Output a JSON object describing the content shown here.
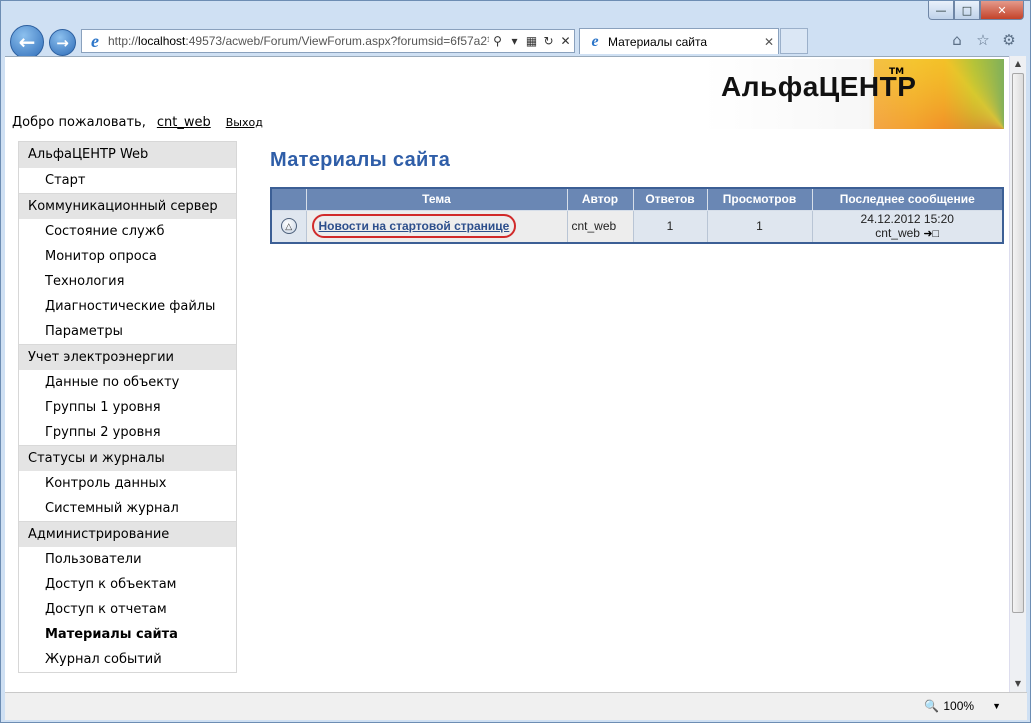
{
  "browser": {
    "url_prefix": "http://",
    "url_host": "localhost",
    "url_rest": ":49573/acweb/Forum/ViewForum.aspx?forumsid=6f57a2¹",
    "tab_title": "Материалы сайта",
    "zoom": "100%",
    "icons": [
      "back-arrow-icon",
      "forward-arrow-icon",
      "ie-icon",
      "search-icon",
      "compatibility-icon",
      "refresh-icon",
      "stop-icon",
      "home-icon",
      "favorites-star-icon",
      "tools-gear-icon",
      "zoom-icon"
    ]
  },
  "header": {
    "logo_text": "АльфаЦЕНТР",
    "logo_tm": "TM",
    "welcome": "Добро пожаловать,",
    "user": "cnt_web",
    "logout": "Выход"
  },
  "sidebar": {
    "groups": [
      {
        "title": "АльфаЦЕНТР Web",
        "items": [
          "Старт"
        ]
      },
      {
        "title": "Коммуникационный сервер",
        "items": [
          "Состояние служб",
          "Монитор опроса",
          "Технология",
          "Диагностические файлы",
          "Параметры"
        ]
      },
      {
        "title": "Учет электроэнергии",
        "items": [
          "Данные по объекту",
          "Группы 1 уровня",
          "Группы 2 уровня"
        ]
      },
      {
        "title": "Статусы и журналы",
        "items": [
          "Контроль данных",
          "Системный журнал"
        ]
      },
      {
        "title": "Администрирование",
        "items": [
          "Пользователи",
          "Доступ к объектам",
          "Доступ к отчетам",
          "Материалы сайта",
          "Журнал событий"
        ]
      }
    ],
    "active_item": "Материалы сайта"
  },
  "main": {
    "title": "Материалы сайта",
    "table": {
      "columns": [
        "",
        "Тема",
        "Автор",
        "Ответов",
        "Просмотров",
        "Последнее сообщение"
      ],
      "rows": [
        {
          "topic": "Новости на стартовой странице",
          "author": "cnt_web",
          "replies": "1",
          "views": "1",
          "last_date": "24.12.2012 15:20",
          "last_author": "cnt_web"
        }
      ]
    }
  },
  "colors": {
    "title_blue": "#2f5ea8",
    "table_header": "#6a87b4",
    "highlight_red": "#d12a2a"
  }
}
